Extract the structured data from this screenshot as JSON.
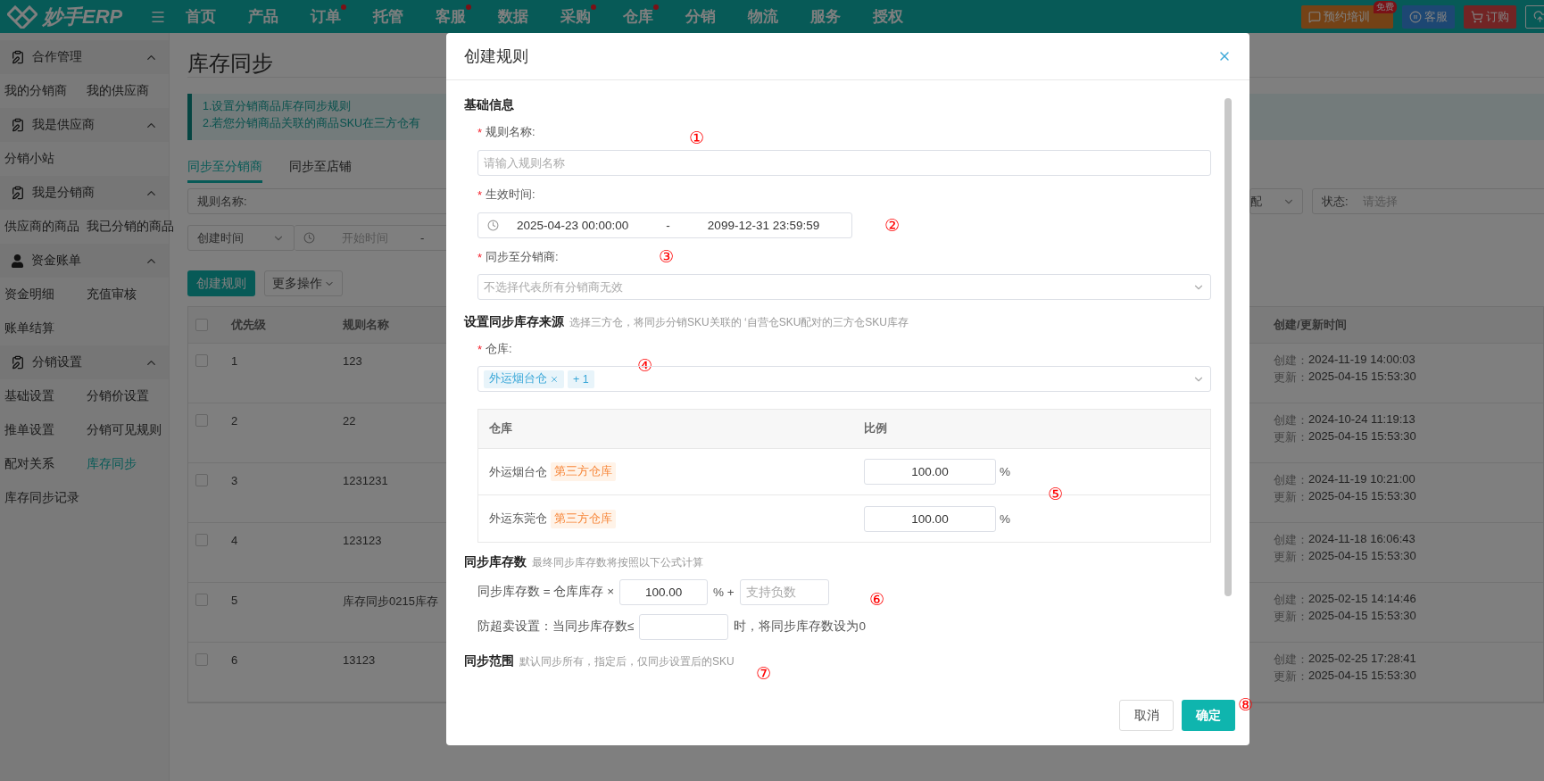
{
  "topbar": {
    "logo": "妙手ERP",
    "nav": [
      {
        "label": "首页",
        "dot": false
      },
      {
        "label": "产品",
        "dot": false
      },
      {
        "label": "订单",
        "dot": true
      },
      {
        "label": "托管",
        "dot": false
      },
      {
        "label": "客服",
        "dot": true
      },
      {
        "label": "数据",
        "dot": false
      },
      {
        "label": "采购",
        "dot": true
      },
      {
        "label": "仓库",
        "dot": true
      },
      {
        "label": "分销",
        "dot": false
      },
      {
        "label": "物流",
        "dot": false
      },
      {
        "label": "服务",
        "dot": false
      },
      {
        "label": "授权",
        "dot": false
      }
    ],
    "actions": [
      {
        "kind": "training",
        "label": "预约培训",
        "badge": "免费"
      },
      {
        "kind": "service",
        "label": "客服"
      },
      {
        "kind": "order",
        "label": "订购"
      },
      {
        "kind": "cloud"
      }
    ]
  },
  "sidebar": {
    "groups": [
      {
        "title": "合作管理",
        "kind": "clipboard",
        "expanded": true,
        "items": [
          {
            "label": "我的分销商",
            "selected": false
          },
          {
            "label": "我的供应商",
            "selected": false
          }
        ]
      },
      {
        "title": "我是供应商",
        "kind": "clipboard",
        "expanded": true,
        "items": [
          {
            "label": "分销小站",
            "selected": false
          }
        ]
      },
      {
        "title": "我是分销商",
        "kind": "clipboard",
        "expanded": true,
        "items": [
          {
            "label": "供应商的商品",
            "selected": false
          },
          {
            "label": "我已分销的商品",
            "selected": false
          }
        ]
      },
      {
        "title": "资金账单",
        "kind": "person",
        "expanded": true,
        "items": [
          {
            "label": "资金明细",
            "selected": false
          },
          {
            "label": "充值审核",
            "selected": false
          },
          {
            "label": "账单结算",
            "selected": false
          }
        ]
      },
      {
        "title": "分销设置",
        "kind": "clipboard",
        "expanded": true,
        "items": [
          {
            "label": "基础设置",
            "selected": false
          },
          {
            "label": "分销价设置",
            "selected": false
          },
          {
            "label": "推单设置",
            "selected": false
          },
          {
            "label": "分销可见规则",
            "selected": false
          },
          {
            "label": "配对关系",
            "selected": false
          },
          {
            "label": "库存同步",
            "selected": true
          },
          {
            "label": "库存同步记录",
            "selected": false
          }
        ]
      }
    ]
  },
  "page": {
    "title": "库存同步",
    "notice": [
      "1.设置分销商品库存同步规则",
      "2.若您分销商品关联的商品SKU在三方仓有"
    ],
    "tabs": [
      {
        "label": "同步至分销商",
        "selected": true
      },
      {
        "label": "同步至店铺",
        "selected": false
      }
    ],
    "filters": {
      "rule_name_label": "规则名称:",
      "cut_select": "配",
      "status_label": "状态:",
      "status_placeholder": "请选择",
      "time_type": "创建时间",
      "start_placeholder": "开始时间",
      "range_separator": "-"
    },
    "buttons": [
      {
        "kind": "primary",
        "label": "创建规则"
      },
      {
        "kind": "dropdown",
        "label": "更多操作"
      }
    ],
    "table": {
      "header_checked": false,
      "columns": [
        "优先级",
        "规则名称",
        "创建/更新时间"
      ],
      "rows": [
        {
          "checked": false,
          "priority": "1",
          "name": "123",
          "created_label": "创建：",
          "created": "2024-11-19 14:00:03",
          "updated_label": "更新：",
          "updated": "2025-04-15 15:53:30"
        },
        {
          "checked": false,
          "priority": "2",
          "name": "22",
          "created_label": "创建：",
          "created": "2024-10-24 11:19:13",
          "updated_label": "更新：",
          "updated": "2025-04-15 15:53:30"
        },
        {
          "checked": false,
          "priority": "3",
          "name": "1231231",
          "created_label": "创建：",
          "created": "2024-11-19 10:21:00",
          "updated_label": "更新：",
          "updated": "2025-04-15 15:53:30"
        },
        {
          "checked": false,
          "priority": "4",
          "name": "123123",
          "created_label": "创建：",
          "created": "2024-11-18 16:06:43",
          "updated_label": "更新：",
          "updated": "2025-04-15 15:53:30"
        },
        {
          "checked": false,
          "priority": "5",
          "name": "库存同步0215库存",
          "created_label": "创建：",
          "created": "2025-02-15 14:14:46",
          "updated_label": "更新：",
          "updated": "2025-04-15 15:53:30"
        },
        {
          "checked": false,
          "priority": "6",
          "name": "13123",
          "created_label": "创建：",
          "created": "2025-02-25 17:28:41",
          "updated_label": "更新：",
          "updated": "2025-04-15 15:53:30"
        }
      ]
    }
  },
  "modal": {
    "title": "创建规则",
    "basic": {
      "title": "基础信息",
      "name_field": {
        "label": "规则名称:",
        "required_mark": "*",
        "placeholder": "请输入规则名称",
        "annotation": "①"
      },
      "effective_time": {
        "label": "生效时间:",
        "required_mark": "*",
        "start": "2025-04-23 00:00:00",
        "separator": "-",
        "end": "2099-12-31 23:59:59",
        "annotation": "②"
      },
      "distributors": {
        "label": "同步至分销商:",
        "required_mark": "*",
        "placeholder": "不选择代表所有分销商无效",
        "annotation": "③"
      }
    },
    "source": {
      "title": "设置同步库存来源",
      "hint": "选择三方仓，将同步分销SKU关联的 ‘自营仓SKU配对的三方仓SKU库存",
      "warehouse": {
        "label": "仓库:",
        "required_mark": "*",
        "tags": [
          {
            "label": "外运烟台仓",
            "removable": true
          },
          {
            "label": "+ 1",
            "removable": false
          }
        ],
        "annotation": "④"
      },
      "table": {
        "columns": [
          "仓库",
          "比例"
        ],
        "annotation": "⑤",
        "rows": [
          {
            "name": "外运烟台仓",
            "tag": "第三方仓库",
            "ratio": "100.00",
            "unit": "%"
          },
          {
            "name": "外运东莞仓",
            "tag": "第三方仓库",
            "ratio": "100.00",
            "unit": "%"
          }
        ]
      }
    },
    "quantity": {
      "title": "同步库存数",
      "hint": "最终同步库存数将按照以下公式计算",
      "annotation": "⑥",
      "formula": {
        "label": "同步库存数 = 仓库库存 ×",
        "ratio": "100.00",
        "unit": "% +",
        "offset_placeholder": "支持负数"
      },
      "oversell": {
        "label": "防超卖设置：当同步库存数≤",
        "suffix": "时，将同步库存数设为0"
      }
    },
    "scope": {
      "title": "同步范围",
      "hint": "默认同步所有，指定后，仅同步设置后的SKU",
      "annotation": "⑦"
    },
    "footer": {
      "cancel": "取消",
      "confirm": "确定",
      "annotation": "⑧"
    }
  }
}
